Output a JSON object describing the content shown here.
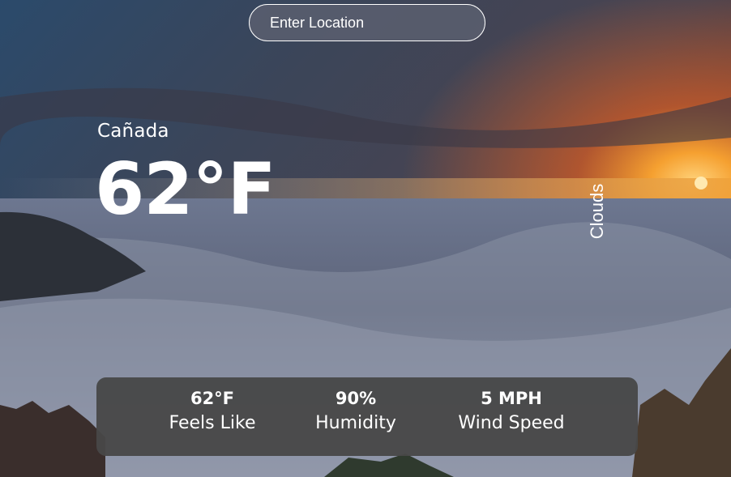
{
  "search": {
    "placeholder": "Enter Location"
  },
  "weather": {
    "location": "Cañada",
    "temperature": "62°F",
    "condition": "Clouds"
  },
  "stats": [
    {
      "value": "62°F",
      "label": "Feels Like"
    },
    {
      "value": "90%",
      "label": "Humidity"
    },
    {
      "value": "5 MPH",
      "label": "Wind Speed"
    }
  ],
  "colors": {
    "stats_panel": "#484848",
    "text": "#ffffff"
  }
}
